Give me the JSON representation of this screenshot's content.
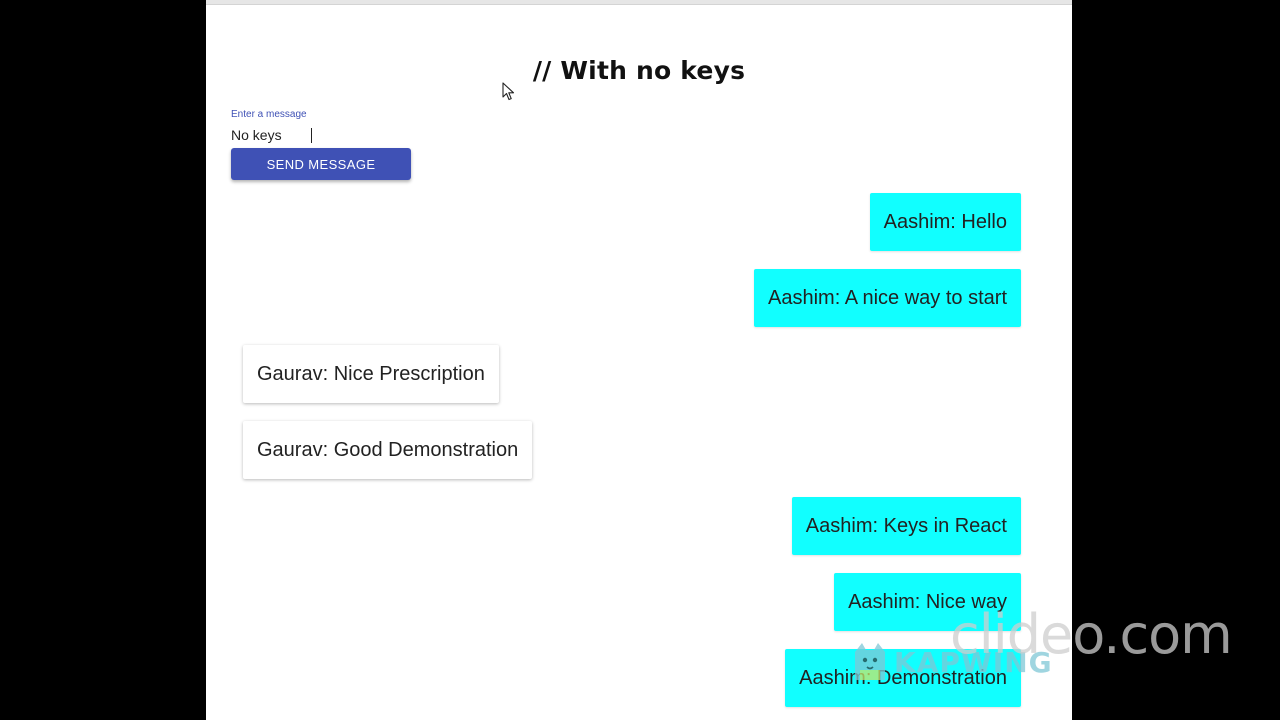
{
  "heading": "// With no keys",
  "form": {
    "label": "Enter a message",
    "value": "No keys",
    "send_label": "SEND MESSAGE"
  },
  "messages": [
    {
      "text": "Aashim: Hello",
      "side": "right"
    },
    {
      "text": "Aashim: A nice way to start",
      "side": "right"
    },
    {
      "text": "Gaurav: Nice Prescription",
      "side": "left"
    },
    {
      "text": "Gaurav: Good Demonstration",
      "side": "left"
    },
    {
      "text": "Aashim: Keys in React",
      "side": "right"
    },
    {
      "text": "Aashim: Nice way",
      "side": "right"
    },
    {
      "text": "Aashim: Demonstration",
      "side": "right"
    }
  ],
  "watermarks": {
    "clideo": "clideo.com",
    "kapwing": "KAPWING"
  },
  "colors": {
    "accent": "#3f51b5",
    "own_bubble": "#11ffff",
    "other_bubble": "#ffffff"
  }
}
